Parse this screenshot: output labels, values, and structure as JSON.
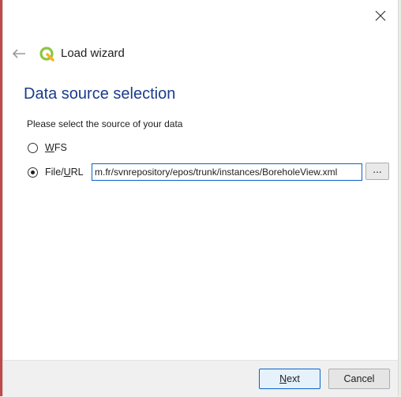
{
  "window": {
    "title": "Load wizard",
    "close_icon": "close-icon",
    "back_icon": "back-arrow-icon",
    "logo": "qgis-logo"
  },
  "page": {
    "heading": "Data source selection",
    "prompt": "Please select the source of your data"
  },
  "options": {
    "wfs": {
      "label_underlined": "W",
      "label_rest": "FS",
      "checked": false
    },
    "file_url": {
      "label_plain": "File/",
      "label_underlined": "U",
      "label_rest": "RL",
      "checked": true
    }
  },
  "url_field": {
    "value": "m.fr/svnrepository/epos/trunk/instances/BoreholeView.xml"
  },
  "browse_button": {
    "label": "..."
  },
  "footer": {
    "next_label_underlined": "N",
    "next_label_rest": "ext",
    "cancel_label": "Cancel"
  },
  "colors": {
    "heading": "#1a3c8c",
    "focus_border": "#0a64c8",
    "logo_green": "#8dc63f"
  }
}
